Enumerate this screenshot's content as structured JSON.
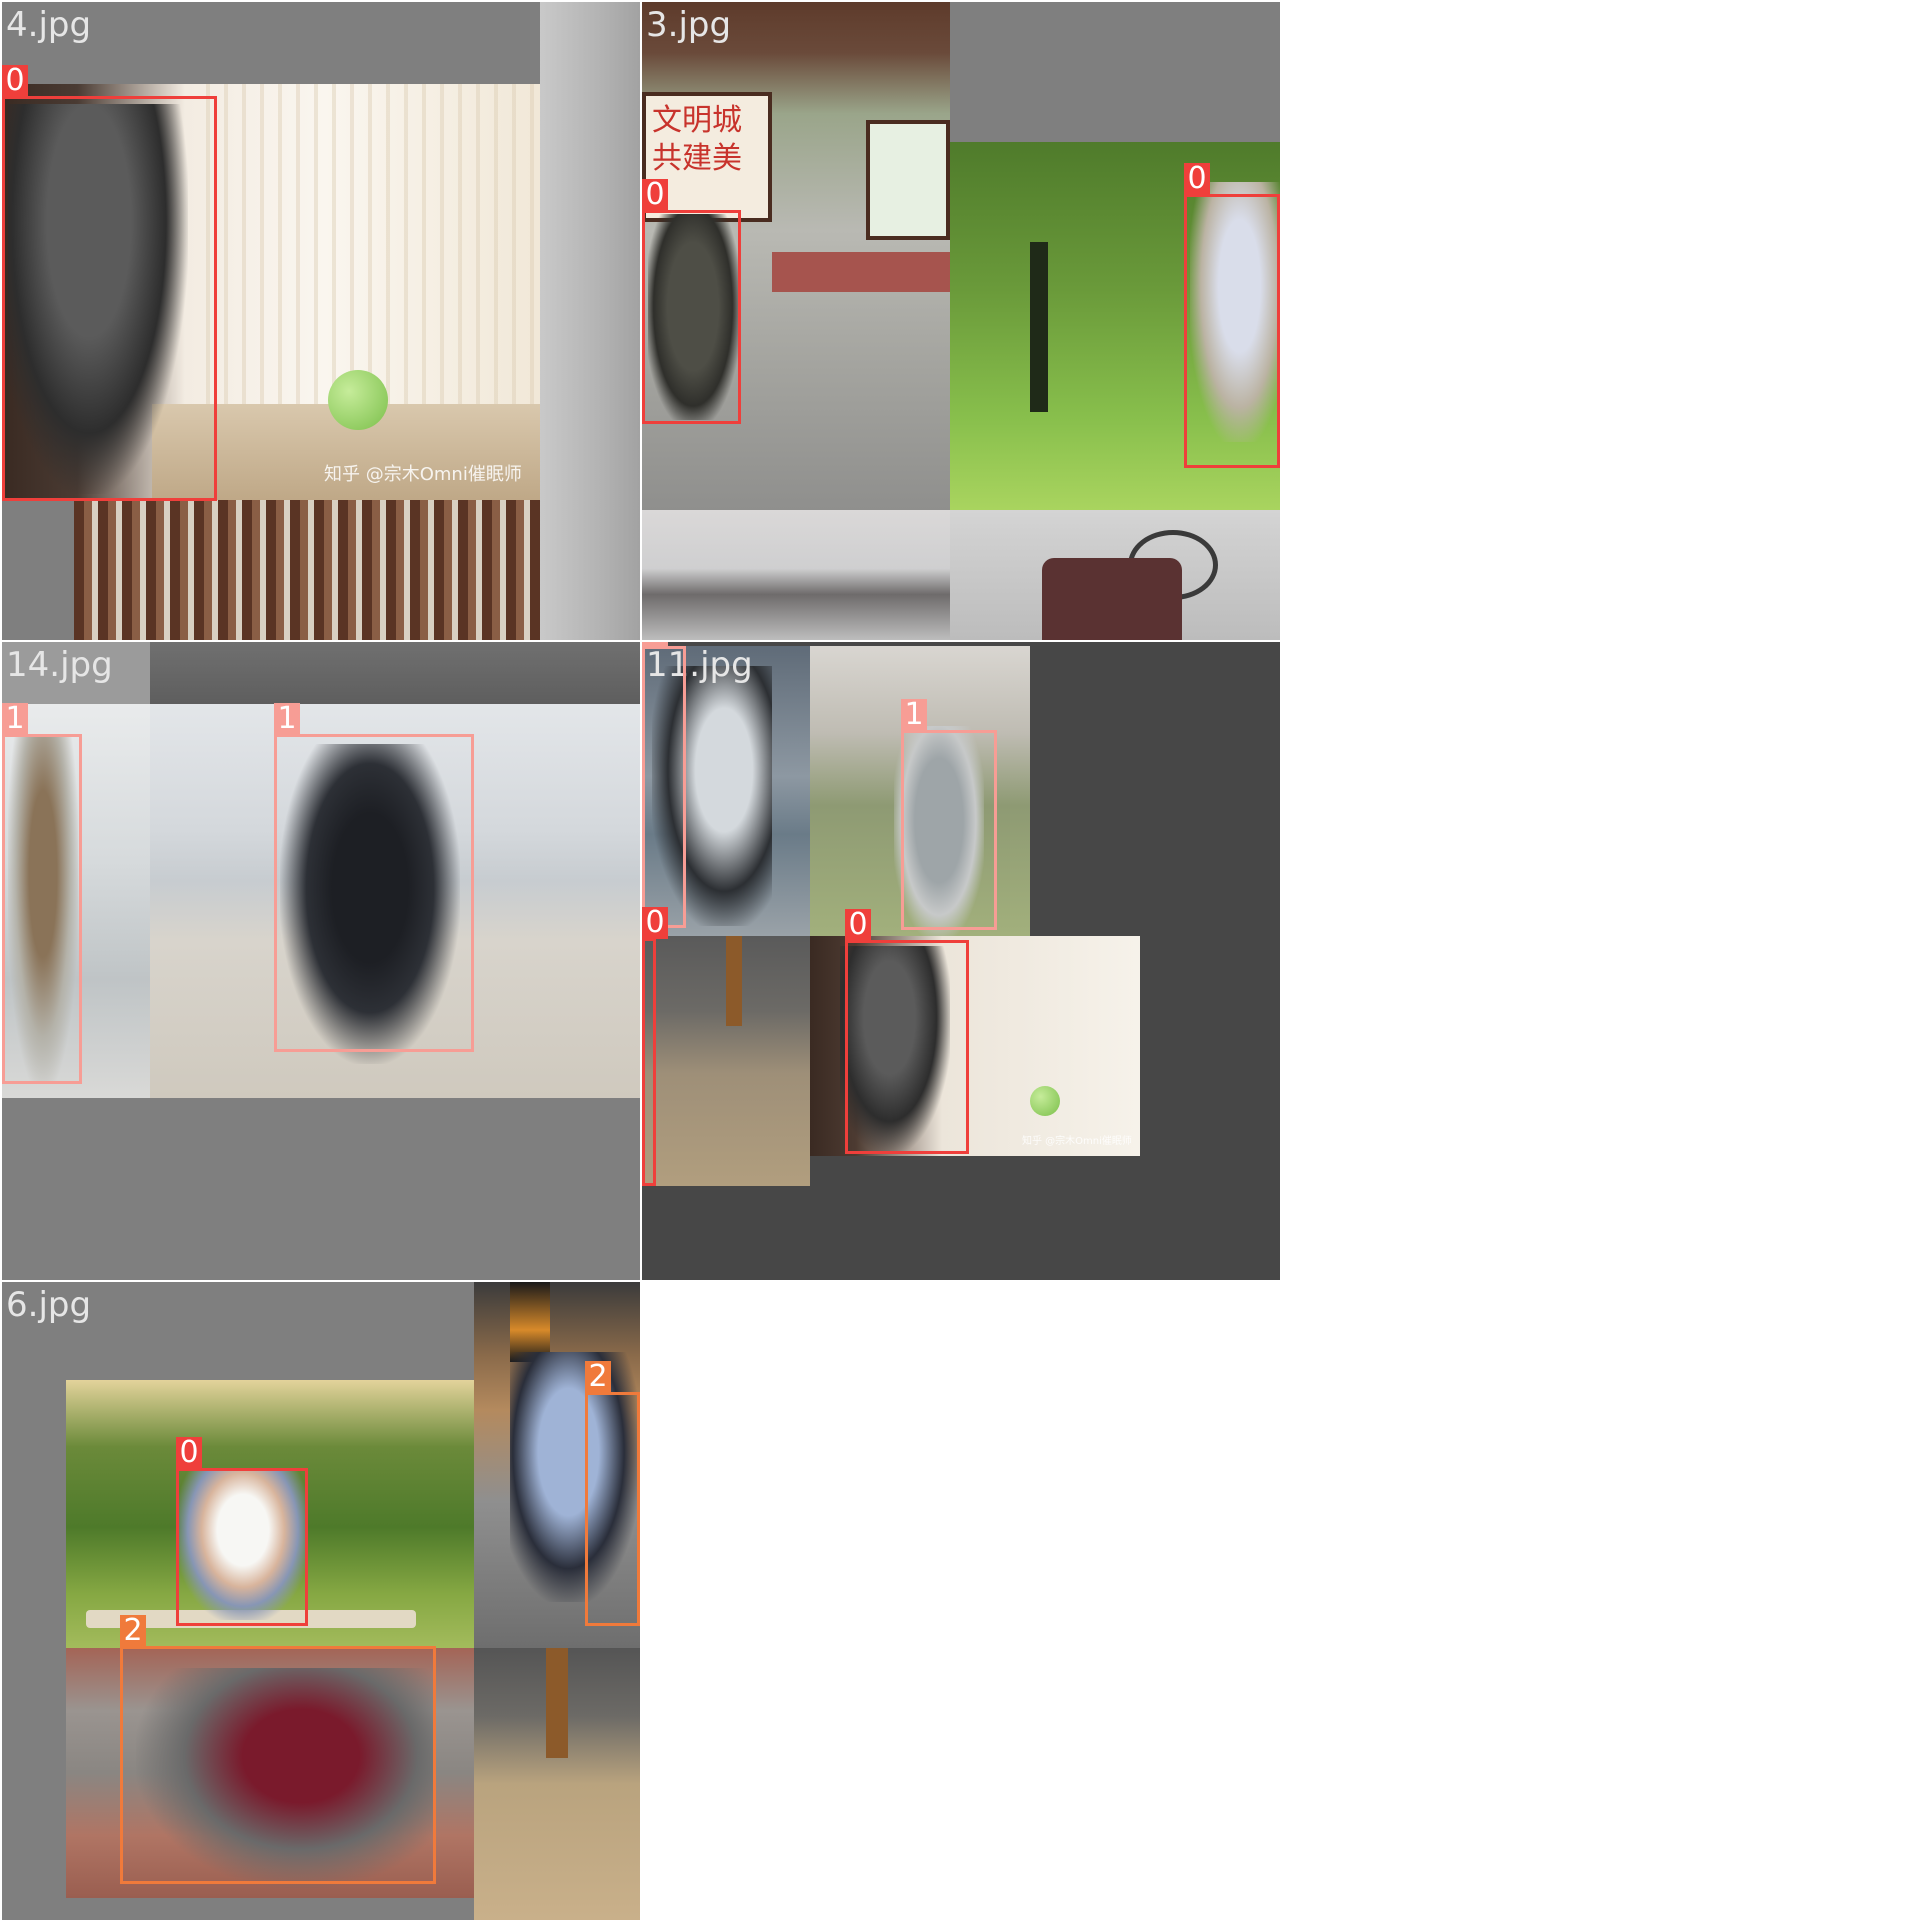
{
  "colors": {
    "class_0": "#ef3f3b",
    "class_1": "#f79d95",
    "class_2": "#f07a3b",
    "tile_gray": "#7f7f7f",
    "tile_dark": "#474747"
  },
  "tiles": [
    {
      "label": "4.jpg",
      "boxes": [
        {
          "class": "0"
        }
      ],
      "watermark": "知乎 @宗木Omni催眠师"
    },
    {
      "label": "3.jpg",
      "boxes": [
        {
          "class": "0"
        },
        {
          "class": "0"
        }
      ],
      "signage": "文明城 共建美"
    },
    {
      "label": "14.jpg",
      "boxes": [
        {
          "class": "1"
        },
        {
          "class": "1"
        }
      ]
    },
    {
      "label": "11.jpg",
      "boxes": [
        {
          "class": "1"
        },
        {
          "class": "1"
        },
        {
          "class": "0"
        },
        {
          "class": "0"
        }
      ],
      "watermark": "知乎 @宗木Omni催眠师"
    },
    {
      "label": "6.jpg",
      "boxes": [
        {
          "class": "0"
        },
        {
          "class": "2"
        },
        {
          "class": "2"
        }
      ]
    }
  ]
}
